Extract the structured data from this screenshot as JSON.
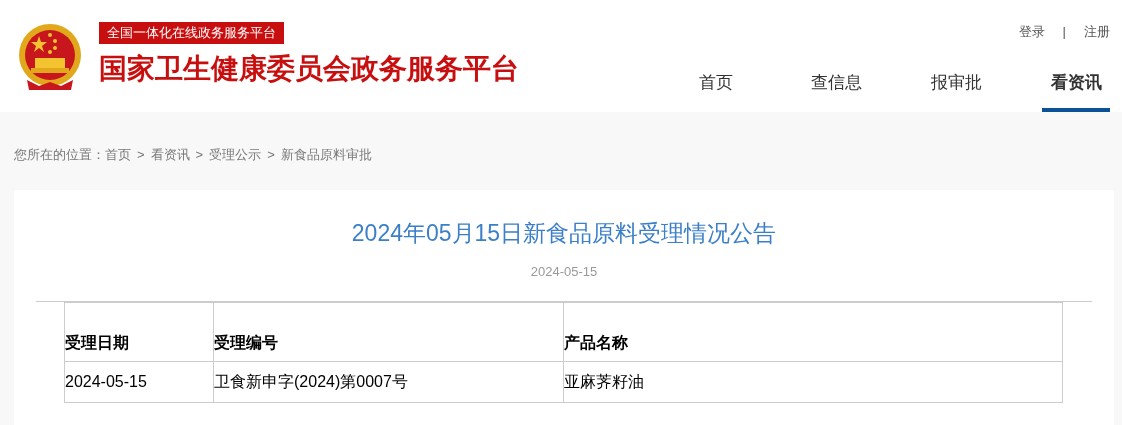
{
  "header": {
    "badge": "全国一体化在线政务服务平台",
    "site_title": "国家卫生健康委员会政务服务平台"
  },
  "account_links": [
    {
      "label": "登录"
    },
    {
      "label": "注册"
    }
  ],
  "account_divider": "|",
  "nav": [
    {
      "label": "首页",
      "selected": false
    },
    {
      "label": "查信息",
      "selected": false
    },
    {
      "label": "报审批",
      "selected": false
    },
    {
      "label": "看资讯",
      "selected": true
    }
  ],
  "breadcrumb": {
    "prefix": "您所在的位置：",
    "separator": ">",
    "items": [
      "首页",
      "看资讯",
      "受理公示",
      "新食品原料审批"
    ]
  },
  "article": {
    "title": "2024年05月15日新食品原料受理情况公告",
    "date": "2024-05-15"
  },
  "table": {
    "columns": [
      "受理日期",
      "受理编号",
      "产品名称"
    ],
    "rows": [
      [
        "2024-05-15",
        "卫食新申字(2024)第0007号",
        "亚麻荠籽油"
      ]
    ]
  }
}
